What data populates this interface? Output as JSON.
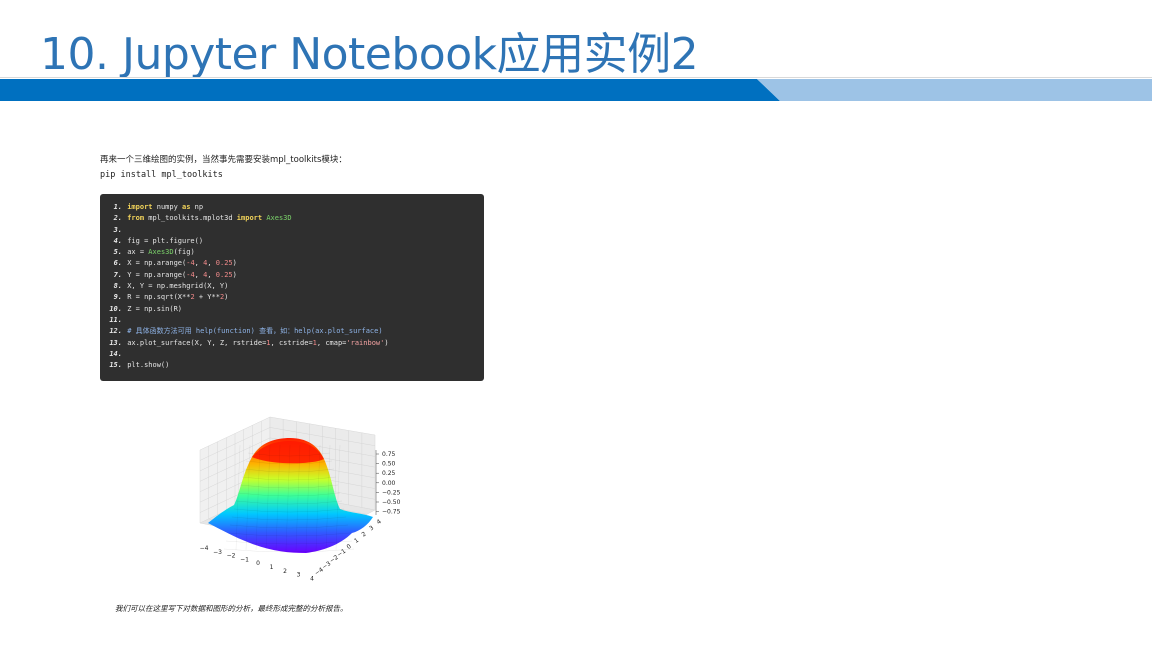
{
  "slide": {
    "title": "10. Jupyter Notebook应用实例2",
    "intro_text": "再来一个三维绘图的实例，当然事先需要安装mpl_toolkits模块：",
    "pip_command": "pip install mpl_toolkits",
    "footer_note": "我们可以在这里写下对数据和图形的分析，最终形成完整的分析报告。"
  },
  "code": {
    "lines": [
      {
        "n": "1.",
        "tokens": [
          {
            "t": "import",
            "c": "kw"
          },
          {
            "t": " numpy "
          },
          {
            "t": "as",
            "c": "kw"
          },
          {
            "t": " np"
          }
        ]
      },
      {
        "n": "2.",
        "tokens": [
          {
            "t": "from",
            "c": "kw"
          },
          {
            "t": " mpl_toolkits.mplot3d "
          },
          {
            "t": "import",
            "c": "kw"
          },
          {
            "t": " "
          },
          {
            "t": "Axes3D",
            "c": "cls"
          }
        ]
      },
      {
        "n": "3.",
        "tokens": []
      },
      {
        "n": "4.",
        "tokens": [
          {
            "t": "fig = plt.figure()"
          }
        ]
      },
      {
        "n": "5.",
        "tokens": [
          {
            "t": "ax = "
          },
          {
            "t": "Axes3D",
            "c": "cls"
          },
          {
            "t": "(fig)"
          }
        ]
      },
      {
        "n": "6.",
        "tokens": [
          {
            "t": "X = np.arange("
          },
          {
            "t": "-4",
            "c": "num"
          },
          {
            "t": ", "
          },
          {
            "t": "4",
            "c": "num"
          },
          {
            "t": ", "
          },
          {
            "t": "0.25",
            "c": "num"
          },
          {
            "t": ")"
          }
        ]
      },
      {
        "n": "7.",
        "tokens": [
          {
            "t": "Y = np.arange("
          },
          {
            "t": "-4",
            "c": "num"
          },
          {
            "t": ", "
          },
          {
            "t": "4",
            "c": "num"
          },
          {
            "t": ", "
          },
          {
            "t": "0.25",
            "c": "num"
          },
          {
            "t": ")"
          }
        ]
      },
      {
        "n": "8.",
        "tokens": [
          {
            "t": "X, Y = np.meshgrid(X, Y)"
          }
        ]
      },
      {
        "n": "9.",
        "tokens": [
          {
            "t": "R = np.sqrt(X**"
          },
          {
            "t": "2",
            "c": "num"
          },
          {
            "t": " + Y**"
          },
          {
            "t": "2",
            "c": "num"
          },
          {
            "t": ")"
          }
        ]
      },
      {
        "n": "10.",
        "tokens": [
          {
            "t": "Z = np.sin(R)"
          }
        ]
      },
      {
        "n": "11.",
        "tokens": []
      },
      {
        "n": "12.",
        "tokens": [
          {
            "t": "# 具体函数方法可用 help(function) 查看，如：help(ax.plot_surface)",
            "c": "cm"
          }
        ]
      },
      {
        "n": "13.",
        "tokens": [
          {
            "t": "ax.plot_surface(X, Y, Z, rstride="
          },
          {
            "t": "1",
            "c": "num"
          },
          {
            "t": ", cstride="
          },
          {
            "t": "1",
            "c": "num"
          },
          {
            "t": ", cmap="
          },
          {
            "t": "'rainbow'",
            "c": "str"
          },
          {
            "t": ")"
          }
        ]
      },
      {
        "n": "14.",
        "tokens": []
      },
      {
        "n": "15.",
        "tokens": [
          {
            "t": "plt.show()"
          }
        ]
      }
    ]
  },
  "plot": {
    "z_ticks": [
      "0.75",
      "0.50",
      "0.25",
      "0.00",
      "−0.25",
      "−0.50",
      "−0.75"
    ],
    "x_ticks": [
      "−4",
      "−3",
      "−2",
      "−1",
      "0",
      "1",
      "2",
      "3",
      "4"
    ],
    "y_ticks": [
      "−4",
      "−3",
      "−2",
      "−1",
      "0",
      "1",
      "2",
      "3",
      "4"
    ]
  },
  "colors": {
    "title": "#2e74b5",
    "band_dark": "#0070c0",
    "band_light": "#9dc3e6",
    "code_bg": "#2f2f2f"
  }
}
